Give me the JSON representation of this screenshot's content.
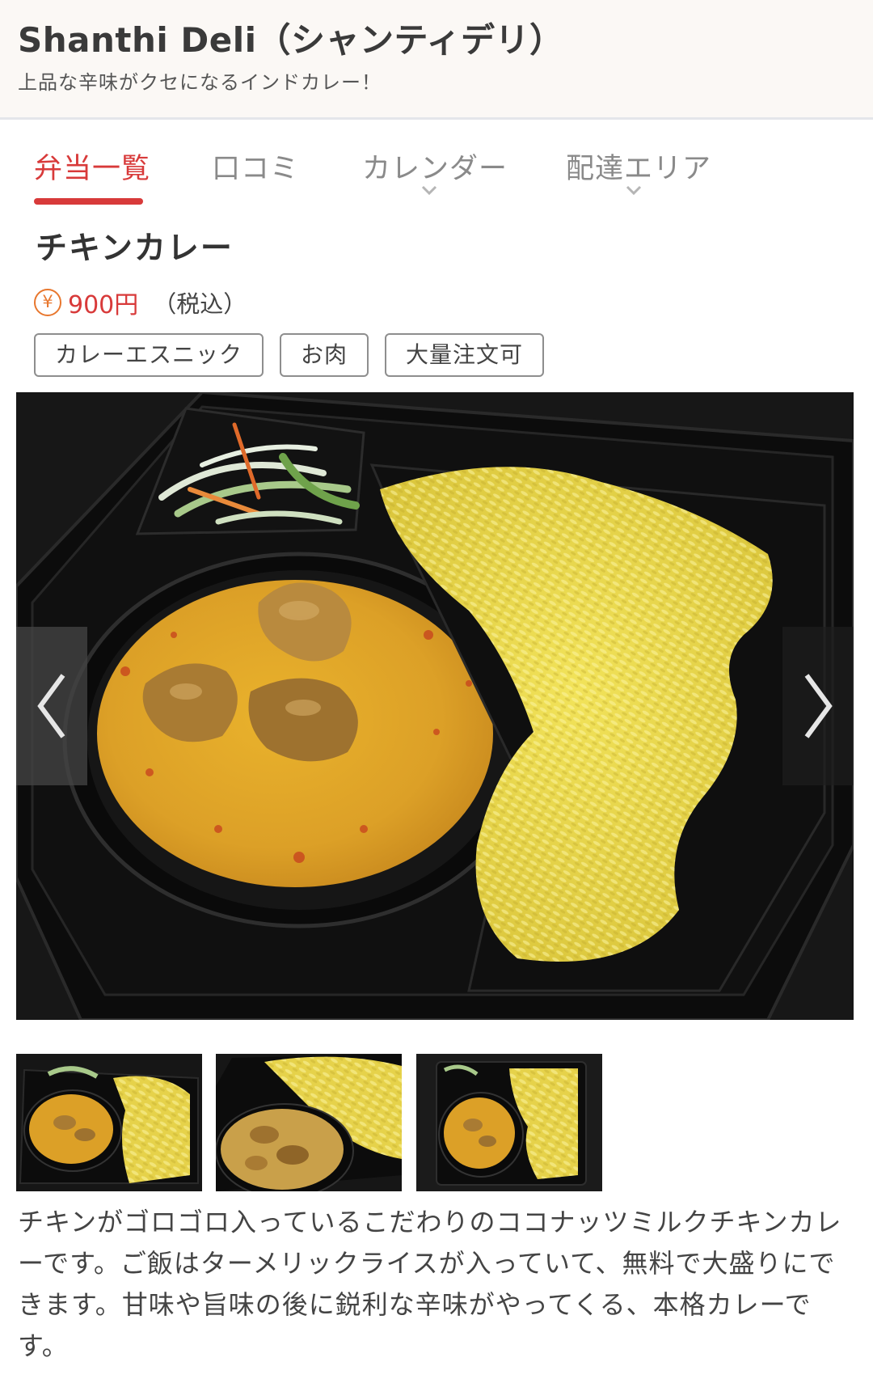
{
  "header": {
    "shop_name": "Shanthi Deli（シャンティデリ）",
    "tagline": "上品な辛味がクセになるインドカレー！"
  },
  "tabs": [
    {
      "label": "弁当一覧",
      "active": true
    },
    {
      "label": "口コミ",
      "active": false
    },
    {
      "label": "カレンダー",
      "active": false,
      "icon": "chevron-down-icon"
    },
    {
      "label": "配達エリア",
      "active": false,
      "icon": "chevron-down-icon"
    }
  ],
  "product": {
    "name": "チキンカレー",
    "currency_icon": "yen-icon",
    "currency_symbol": "¥",
    "price": "900円",
    "tax_note": "（税込）",
    "tags": [
      "カレーエスニック",
      "お肉",
      "大量注文可"
    ],
    "description": "チキンがゴロゴロ入っているこだわりのココナッツミルクチキンカレーです。ご飯はターメリックライスが入っていて、無料で大盛りにできます。甘味や旨味の後に鋭利な辛味がやってくる、本格カレーです。"
  },
  "gallery": {
    "main_image": "chicken-curry-bento-photo",
    "prev_icon": "chevron-left-icon",
    "next_icon": "chevron-right-icon",
    "thumbnails": [
      "thumbnail-1",
      "thumbnail-2",
      "thumbnail-3"
    ]
  },
  "colors": {
    "accent": "#d83a3a",
    "price_icon": "#e8772e",
    "header_bg": "#fbf8f5",
    "tab_inactive": "#8a8a8a"
  }
}
